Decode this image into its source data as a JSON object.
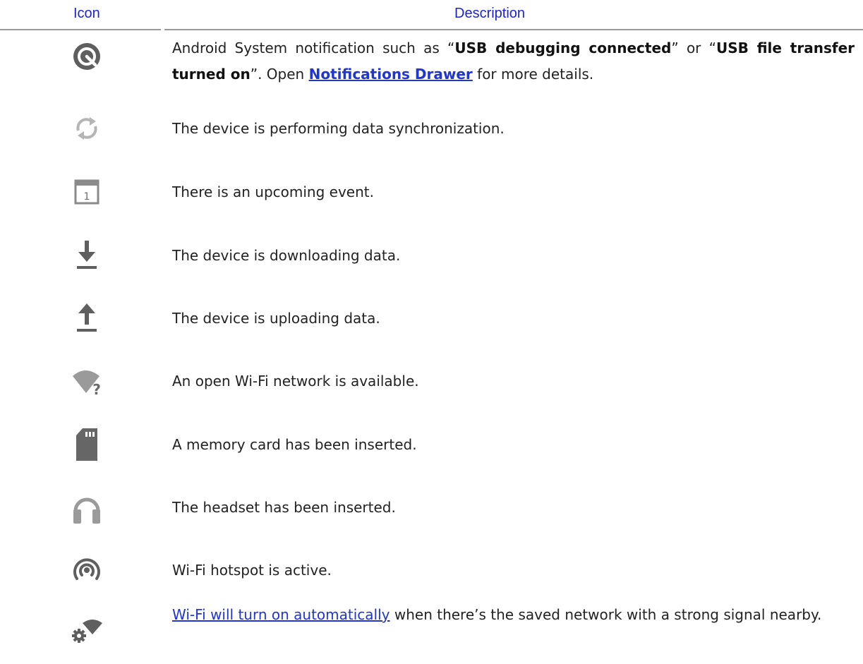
{
  "header": {
    "icon_label": "Icon",
    "description_label": "Description"
  },
  "rows": [
    {
      "icon": "android-system-notification-icon",
      "parts": {
        "p1": "Android System notification such as “",
        "b1": "USB debugging connected",
        "p2": "” or “",
        "b2": "USB file transfer turned on",
        "p3": "”. Open ",
        "link": "Notifications Drawer",
        "p4": " for more details."
      }
    },
    {
      "icon": "sync-icon",
      "text": "The device is performing data synchronization."
    },
    {
      "icon": "calendar-event-icon",
      "text": "There is an upcoming event.",
      "calendar_day": "1"
    },
    {
      "icon": "download-icon",
      "text": "The device is downloading data."
    },
    {
      "icon": "upload-icon",
      "text": "The device is uploading data."
    },
    {
      "icon": "open-wifi-icon",
      "text": "An open Wi-Fi network is available.",
      "icon_glyph": "?"
    },
    {
      "icon": "memory-card-icon",
      "text": "A memory card has been inserted."
    },
    {
      "icon": "headset-icon",
      "text": "The headset has been inserted."
    },
    {
      "icon": "wifi-hotspot-icon",
      "text": "Wi-Fi hotspot is active."
    },
    {
      "icon": "wifi-auto-on-icon",
      "parts": {
        "link": "Wi-Fi will turn on automatically",
        "p1": " when there’s the saved network with a strong signal nearby."
      }
    }
  ],
  "colors": {
    "header_text": "#1E22D8",
    "link": "#1f35d6",
    "icon_gray": "#8a8a8a",
    "icon_dark": "#5f5f5f",
    "rule": "#9a9a9a"
  }
}
